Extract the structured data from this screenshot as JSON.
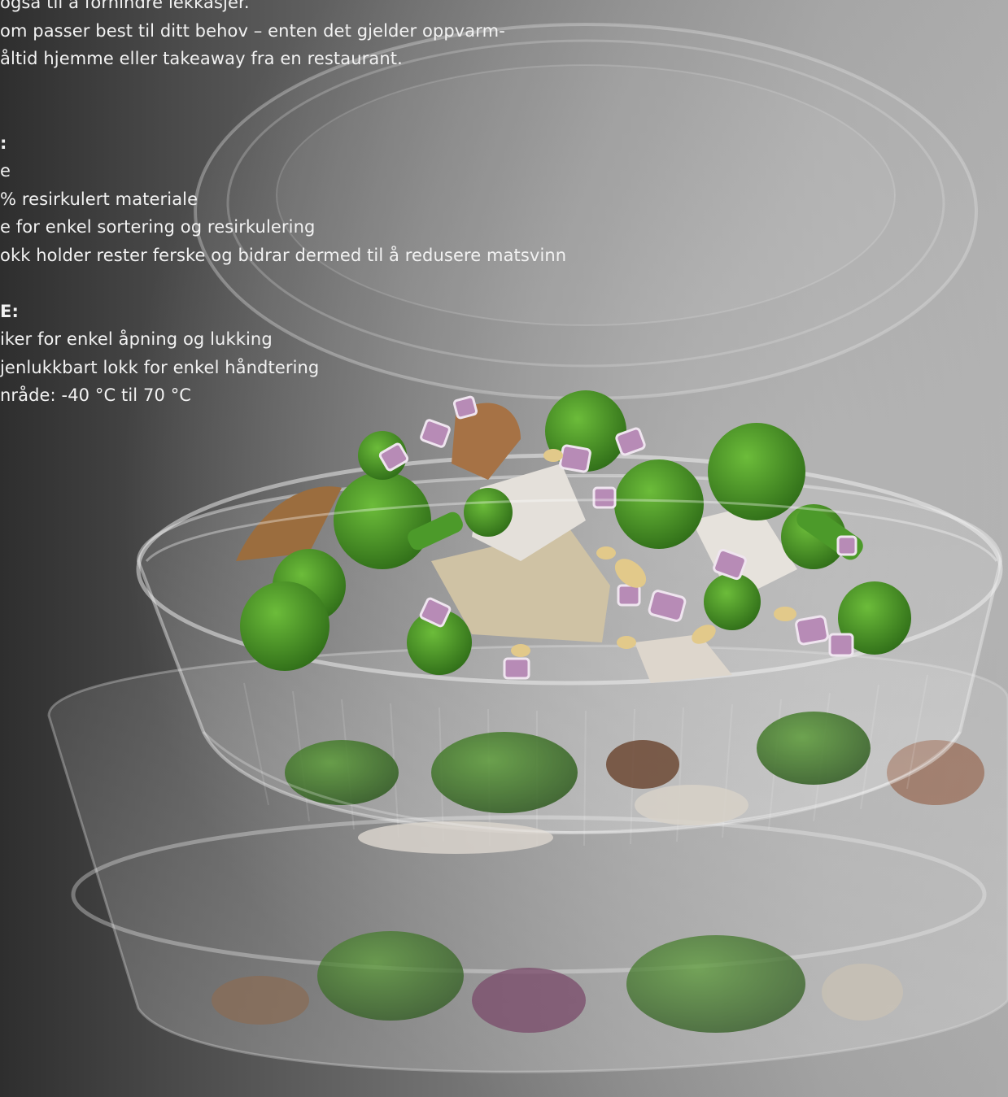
{
  "intro": {
    "line1": "også til å forhindre lekkasjer.",
    "line2": "om passer best til ditt behov – enten det gjelder oppvarm-",
    "line3": "åltid hjemme eller takeaway fra en restaurant."
  },
  "section1": {
    "heading": ":",
    "items": [
      "e",
      "% resirkulert materiale",
      "e for enkel sortering og resirkulering",
      "okk holder rester ferske og bidrar dermed til å redusere matsvinn"
    ]
  },
  "section2": {
    "heading": "E:",
    "items": [
      "iker for enkel åpning og lukking",
      "jenlukkbart lokk for enkel håndtering",
      "nråde: -40 °C til 70 °C"
    ]
  },
  "colors": {
    "text": "#f2f2f2",
    "background_dark": "#2e2e2e",
    "background_light": "#aaaaaa"
  }
}
